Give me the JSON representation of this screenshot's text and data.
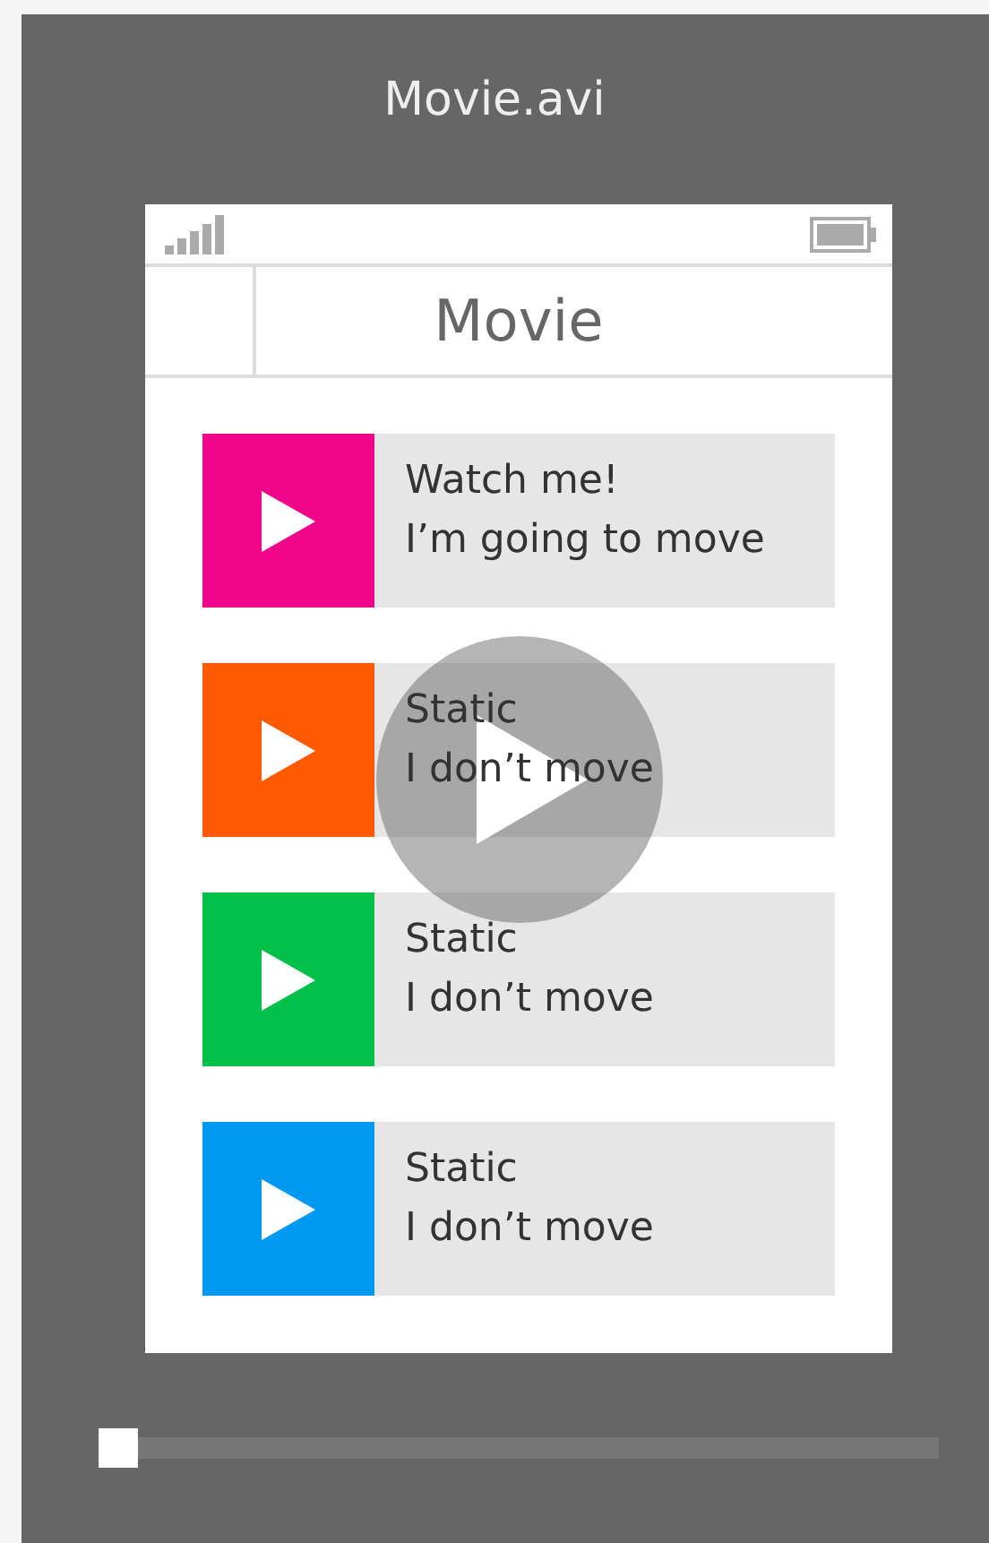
{
  "window": {
    "title": "Movie.avi"
  },
  "phone": {
    "header": {
      "title": "Movie"
    },
    "items": [
      {
        "color": "#f0068a",
        "title": "Watch me!",
        "subtitle": "I’m going to move"
      },
      {
        "color": "#ff5a00",
        "title": "Static",
        "subtitle": "I don’t move"
      },
      {
        "color": "#00c04a",
        "title": "Static",
        "subtitle": "I don’t move"
      },
      {
        "color": "#0099f2",
        "title": "Static",
        "subtitle": "I don’t move"
      }
    ]
  },
  "scrubber": {
    "level": 0
  }
}
